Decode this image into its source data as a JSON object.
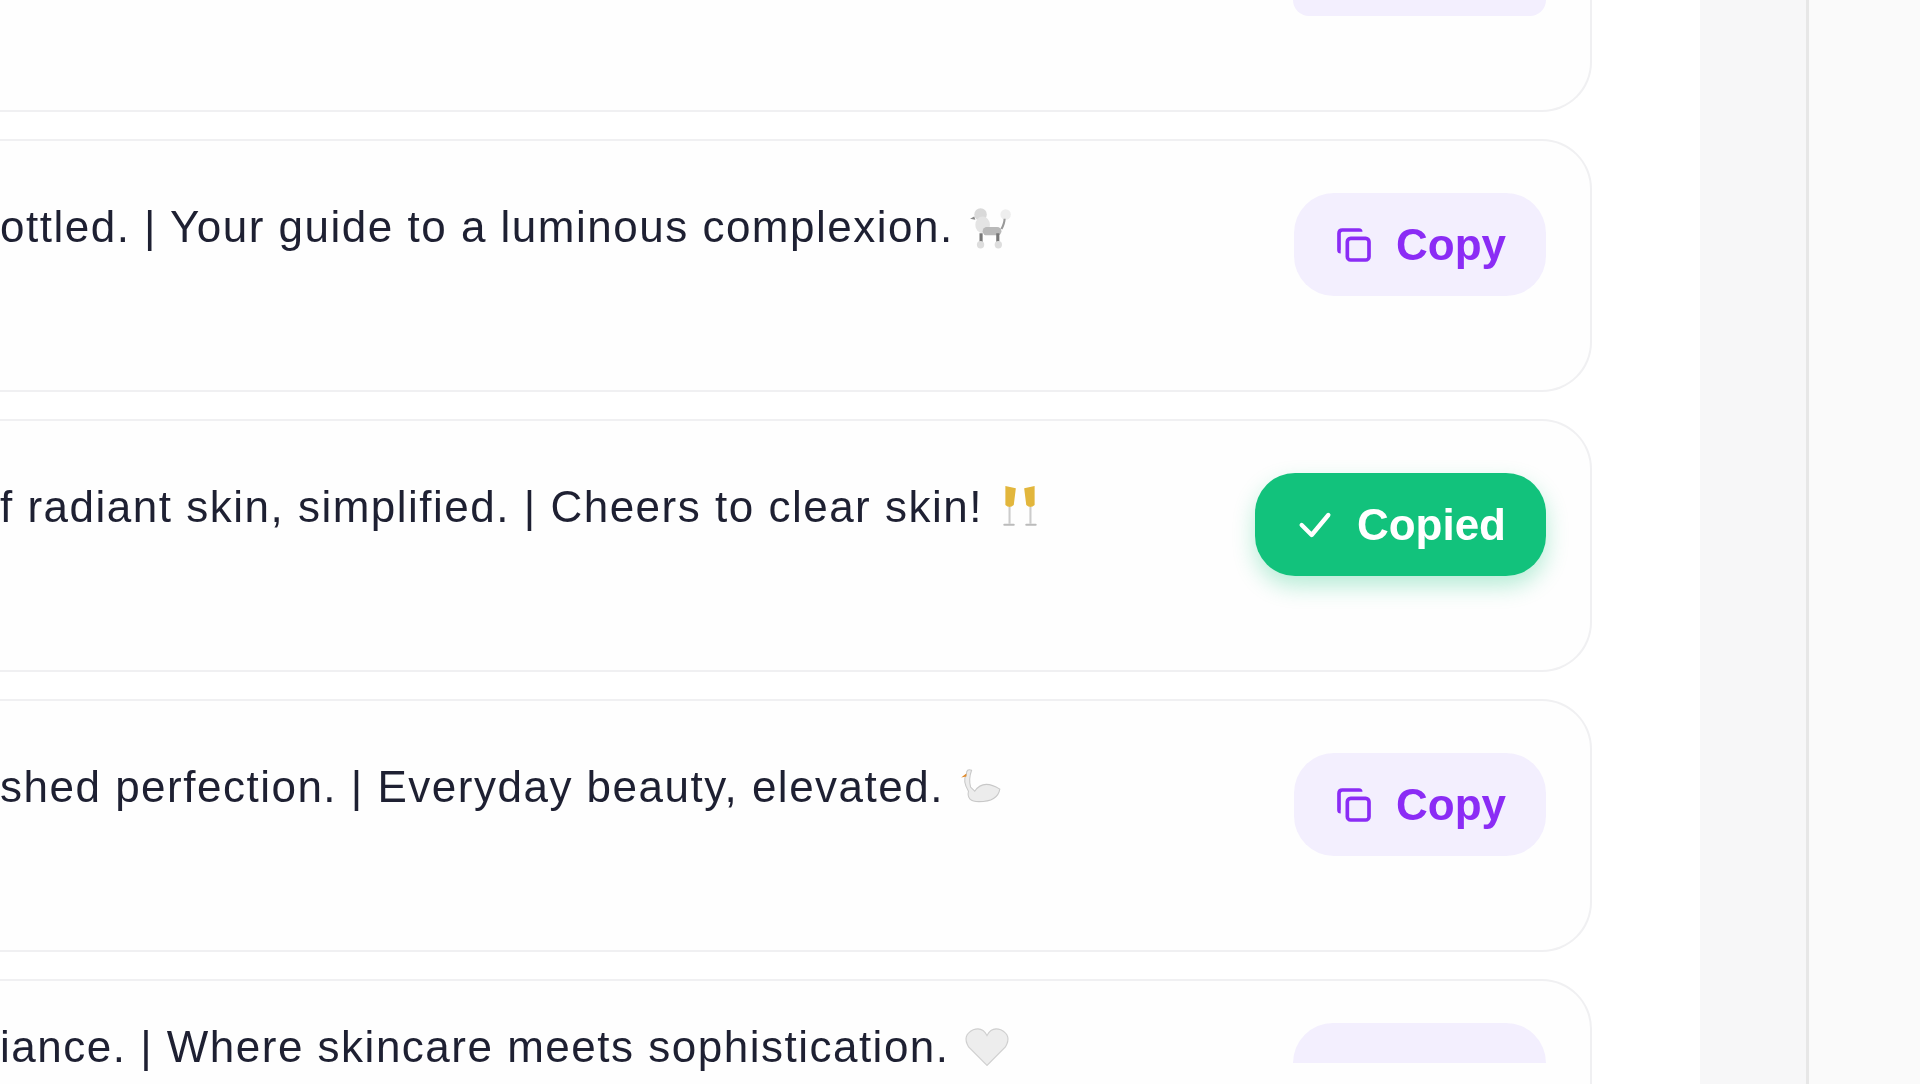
{
  "cards": [
    {
      "kind": "stub",
      "button": {
        "copied": false
      }
    },
    {
      "kind": "full",
      "text": "ottled. | Your guide to a luminous complexion.",
      "button": {
        "label": "Copy",
        "copied": false
      }
    },
    {
      "kind": "full",
      "text": "f radiant skin, simplified. | Cheers to clear skin!",
      "button": {
        "label": "Copied",
        "copied": true
      }
    },
    {
      "kind": "full",
      "text": "shed perfection. | Everyday beauty, elevated.",
      "button": {
        "label": "Copy",
        "copied": false
      }
    },
    {
      "kind": "tail",
      "text": "iance. | Where skincare meets sophistication.",
      "button": {
        "copied": false
      }
    }
  ]
}
